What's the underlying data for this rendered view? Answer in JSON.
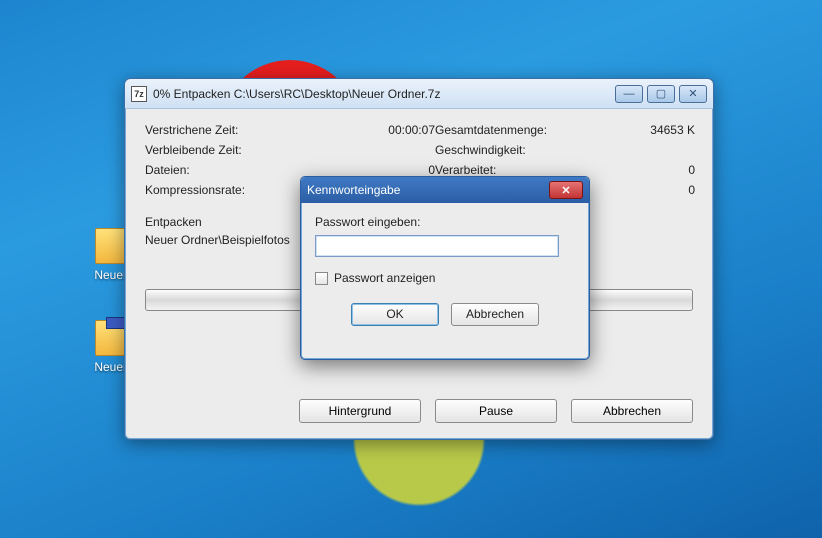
{
  "desktop": {
    "icon1_label": "Neuer Or",
    "icon2_label": "Neuer Or"
  },
  "window": {
    "appicon_text": "7z",
    "title": "0% Entpacken C:\\Users\\RC\\Desktop\\Neuer Ordner.7z",
    "labels": {
      "elapsed": "Verstrichene Zeit:",
      "remaining": "Verbleibende Zeit:",
      "files": "Dateien:",
      "compression": "Kompressionsrate:",
      "total": "Gesamtdatenmenge:",
      "speed": "Geschwindigkeit:",
      "processed": "Verarbeitet:"
    },
    "values": {
      "elapsed": "00:00:07",
      "remaining": "",
      "files": "0",
      "compression": "",
      "total": "34653 K",
      "speed": "",
      "processed": "0",
      "processed2": "0"
    },
    "action_label": "Entpacken",
    "current_file": "Neuer Ordner\\Beispielfotos",
    "buttons": {
      "background": "Hintergrund",
      "pause": "Pause",
      "cancel": "Abbrechen"
    }
  },
  "modal": {
    "title": "Kennworteingabe",
    "prompt": "Passwort eingeben:",
    "password_value": "",
    "show_password": "Passwort anzeigen",
    "ok": "OK",
    "cancel": "Abbrechen"
  }
}
